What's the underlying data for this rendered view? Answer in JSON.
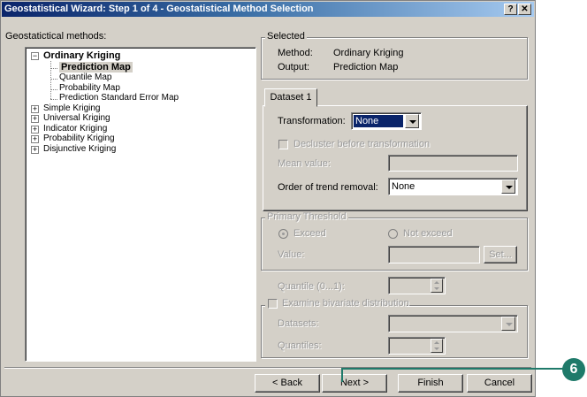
{
  "window": {
    "title": "Geostatistical Wizard: Step 1 of 4 - Geostatistical Method Selection",
    "help_label": "?",
    "close_label": "✕"
  },
  "methods": {
    "label": "Geostatictical methods:",
    "items": [
      {
        "label": "Ordinary Kriging",
        "expanded": true,
        "bold": true,
        "children": [
          {
            "label": "Prediction Map",
            "selected": true
          },
          {
            "label": "Quantile Map"
          },
          {
            "label": "Probability Map"
          },
          {
            "label": "Prediction Standard Error Map"
          }
        ]
      },
      {
        "label": "Simple Kriging",
        "expanded": false
      },
      {
        "label": "Universal Kriging",
        "expanded": false
      },
      {
        "label": "Indicator Kriging",
        "expanded": false
      },
      {
        "label": "Probability Kriging",
        "expanded": false
      },
      {
        "label": "Disjunctive Kriging",
        "expanded": false
      }
    ],
    "expand_glyph": "+",
    "collapse_glyph": "−"
  },
  "selected": {
    "legend": "Selected",
    "method_label": "Method:",
    "method_value": "Ordinary Kriging",
    "output_label": "Output:",
    "output_value": "Prediction Map"
  },
  "dataset": {
    "tab_label": "Dataset 1",
    "transformation_label": "Transformation:",
    "transformation_value": "None",
    "decluster_label": "Decluster before transformation",
    "mean_label": "Mean value:",
    "mean_value": "",
    "trend_label": "Order of trend removal:",
    "trend_value": "None"
  },
  "threshold": {
    "legend": "Primary Threshold",
    "exceed_label": "Exceed",
    "not_exceed_label": "Not exceed",
    "value_label": "Value:",
    "value": "",
    "set_label": "Set..."
  },
  "quantile": {
    "label": "Quantile (0...1):",
    "value": ""
  },
  "bivariate": {
    "label": "Examine bivariate distribution",
    "datasets_label": "Datasets:",
    "datasets_value": "",
    "quantiles_label": "Quantiles:",
    "quantiles_value": ""
  },
  "footer": {
    "back_label": "< Back",
    "next_label": "Next >",
    "finish_label": "Finish",
    "cancel_label": "Cancel"
  },
  "callout": {
    "number": "6",
    "color": "#1f7a6a"
  }
}
